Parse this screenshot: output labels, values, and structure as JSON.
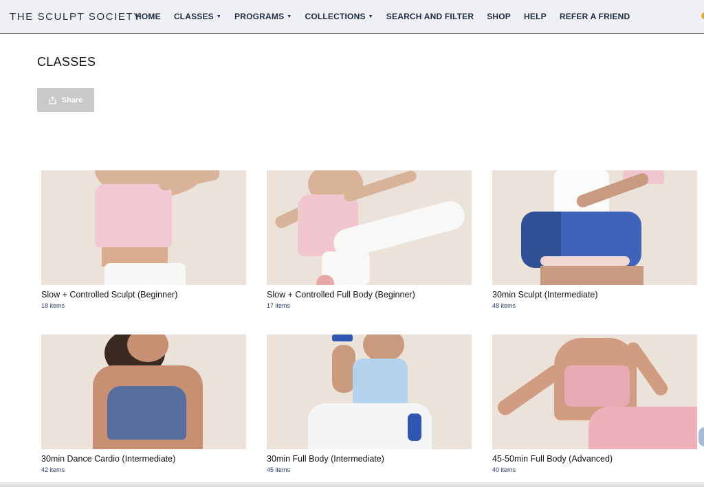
{
  "brand": "THE SCULPT SOCIETY",
  "nav": [
    {
      "label": "HOME",
      "dropdown": false
    },
    {
      "label": "CLASSES",
      "dropdown": true
    },
    {
      "label": "PROGRAMS",
      "dropdown": true
    },
    {
      "label": "COLLECTIONS",
      "dropdown": true
    },
    {
      "label": "SEARCH AND FILTER",
      "dropdown": false
    },
    {
      "label": "SHOP",
      "dropdown": false
    },
    {
      "label": "HELP",
      "dropdown": false
    },
    {
      "label": "REFER A FRIEND",
      "dropdown": false
    }
  ],
  "page": {
    "title": "CLASSES",
    "share_label": "Share"
  },
  "cards": [
    {
      "title": "Slow + Controlled Sculpt (Beginner)",
      "count": "18 items"
    },
    {
      "title": "Slow + Controlled Full Body (Beginner)",
      "count": "17 items"
    },
    {
      "title": "30min Sculpt (Intermediate)",
      "count": "48 items"
    },
    {
      "title": "30min Dance Cardio (Intermediate)",
      "count": "42 items"
    },
    {
      "title": "30min Full Body (Intermediate)",
      "count": "45 items"
    },
    {
      "title": "45-50min Full Body (Advanced)",
      "count": "40 items"
    }
  ],
  "colors": {
    "nav_text": "#1f2a44",
    "share_bg": "#c9c9c9",
    "thumb_bg": "#ebe2da",
    "count_text": "#23386b"
  },
  "icons": {
    "share": "share-icon",
    "caret": "chevron-down-icon"
  }
}
